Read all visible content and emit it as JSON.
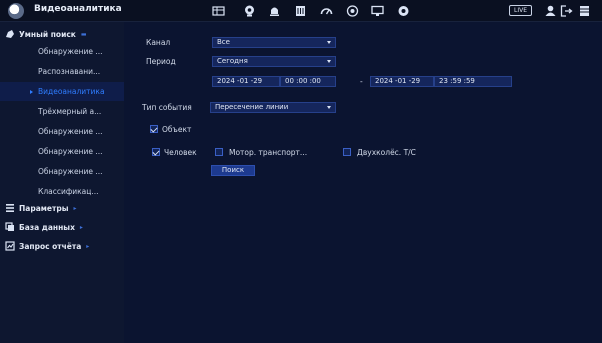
{
  "app": {
    "title": "Видеоаналитика"
  },
  "topbar": {
    "icons": [
      "film-icon",
      "camera-icon",
      "bulb-icon",
      "storage-icon",
      "speedometer-icon",
      "disk-icon",
      "monitor-icon",
      "settings-wheel-icon"
    ],
    "live_label": "LIVE",
    "right_icons": [
      "user-icon",
      "logout-icon",
      "menu-icon"
    ]
  },
  "sidebar": {
    "smart_search": {
      "label": "Умный поиск",
      "icon": "smart-search-icon"
    },
    "items": [
      {
        "label": "Обнаружение ..."
      },
      {
        "label": "Распознавани..."
      },
      {
        "label": "Видеоаналитика"
      },
      {
        "label": "Трёхмерный а..."
      },
      {
        "label": "Обнаружение ..."
      },
      {
        "label": "Обнаружение ..."
      },
      {
        "label": "Обнаружение ..."
      },
      {
        "label": "Классификац..."
      }
    ],
    "active_index": 2,
    "params": {
      "label": "Параметры",
      "icon": "parameters-icon"
    },
    "database": {
      "label": "База данных",
      "icon": "database-icon"
    },
    "report": {
      "label": "Запрос отчёта",
      "icon": "report-icon"
    }
  },
  "form": {
    "channel": {
      "label": "Канал",
      "value": "Все"
    },
    "period": {
      "label": "Период",
      "value": "Сегодня"
    },
    "start": {
      "date": "2024 -01 -29",
      "time": "00 :00 :00"
    },
    "dash": "-",
    "end": {
      "date": "2024 -01 -29",
      "time": "23 :59 :59"
    },
    "event_type": {
      "label": "Тип события",
      "value": "Пересечение линии"
    },
    "object": {
      "label": "Объект",
      "checked": true
    },
    "human": {
      "label": "Человек",
      "checked": true
    },
    "motor": {
      "label": "Мотор. транспорт...",
      "checked": false
    },
    "twowheel": {
      "label": "Двухколёс. Т/С",
      "checked": false
    },
    "search_button": "Поиск"
  }
}
